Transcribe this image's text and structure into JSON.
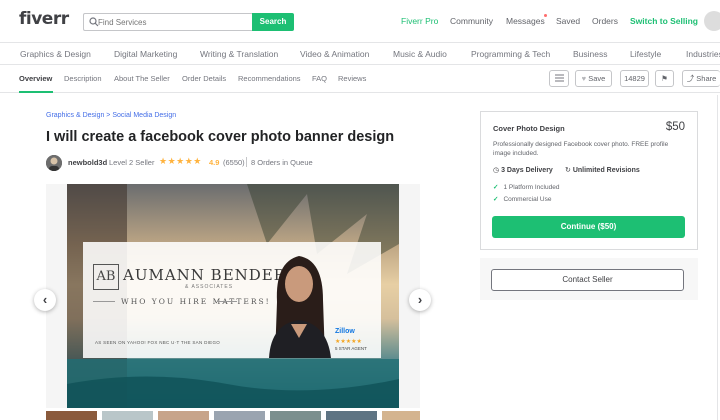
{
  "header": {
    "logo": "fiverr",
    "search_placeholder": "Find Services",
    "search_button": "Search",
    "nav": [
      "Fiverr Pro",
      "Community",
      "Messages",
      "Saved",
      "Orders",
      "Switch to Selling"
    ]
  },
  "categories": [
    "Graphics & Design",
    "Digital Marketing",
    "Writing & Translation",
    "Video & Animation",
    "Music & Audio",
    "Programming & Tech",
    "Business",
    "Lifestyle",
    "Industries"
  ],
  "subnav": {
    "tabs": [
      "Overview",
      "Description",
      "About The Seller",
      "Order Details",
      "Recommendations",
      "FAQ",
      "Reviews"
    ],
    "save_label": "Save",
    "count": "14829",
    "share_label": "Share"
  },
  "gig": {
    "breadcrumb": "Graphics & Design > Social Media Design",
    "title": "I will create a facebook cover photo banner design",
    "seller_name": "newbold3d",
    "seller_level": "Level 2 Seller",
    "stars": "★★★★★",
    "rating": "4.9",
    "reviews": "(6550)",
    "queue": "8 Orders in Queue"
  },
  "banner": {
    "monogram": "AB",
    "brand_name": "AUMANN BENDER",
    "brand_sub": "& ASSOCIATES",
    "tagline": "WHO YOU HIRE MATTERS!",
    "as_seen": "AS SEEN ON  YAHOO!  FOX  NBC  U·T  THE SAN DIEGO",
    "zillow": "Zillow",
    "zillow_stars": "★★★★★",
    "zillow_agent": "5 STAR AGENT"
  },
  "package": {
    "name": "Cover Photo Design",
    "price": "$50",
    "description": "Professionally designed Facebook cover photo. FREE profile image included.",
    "delivery": "3 Days Delivery",
    "revisions": "Unlimited Revisions",
    "features": [
      "1 Platform Included",
      "Commercial Use"
    ],
    "continue_label": "Continue ($50)",
    "contact_label": "Contact Seller"
  },
  "colors": {
    "brand_green": "#1dbf73",
    "link_blue": "#446ee7",
    "star": "#ffb33e"
  }
}
